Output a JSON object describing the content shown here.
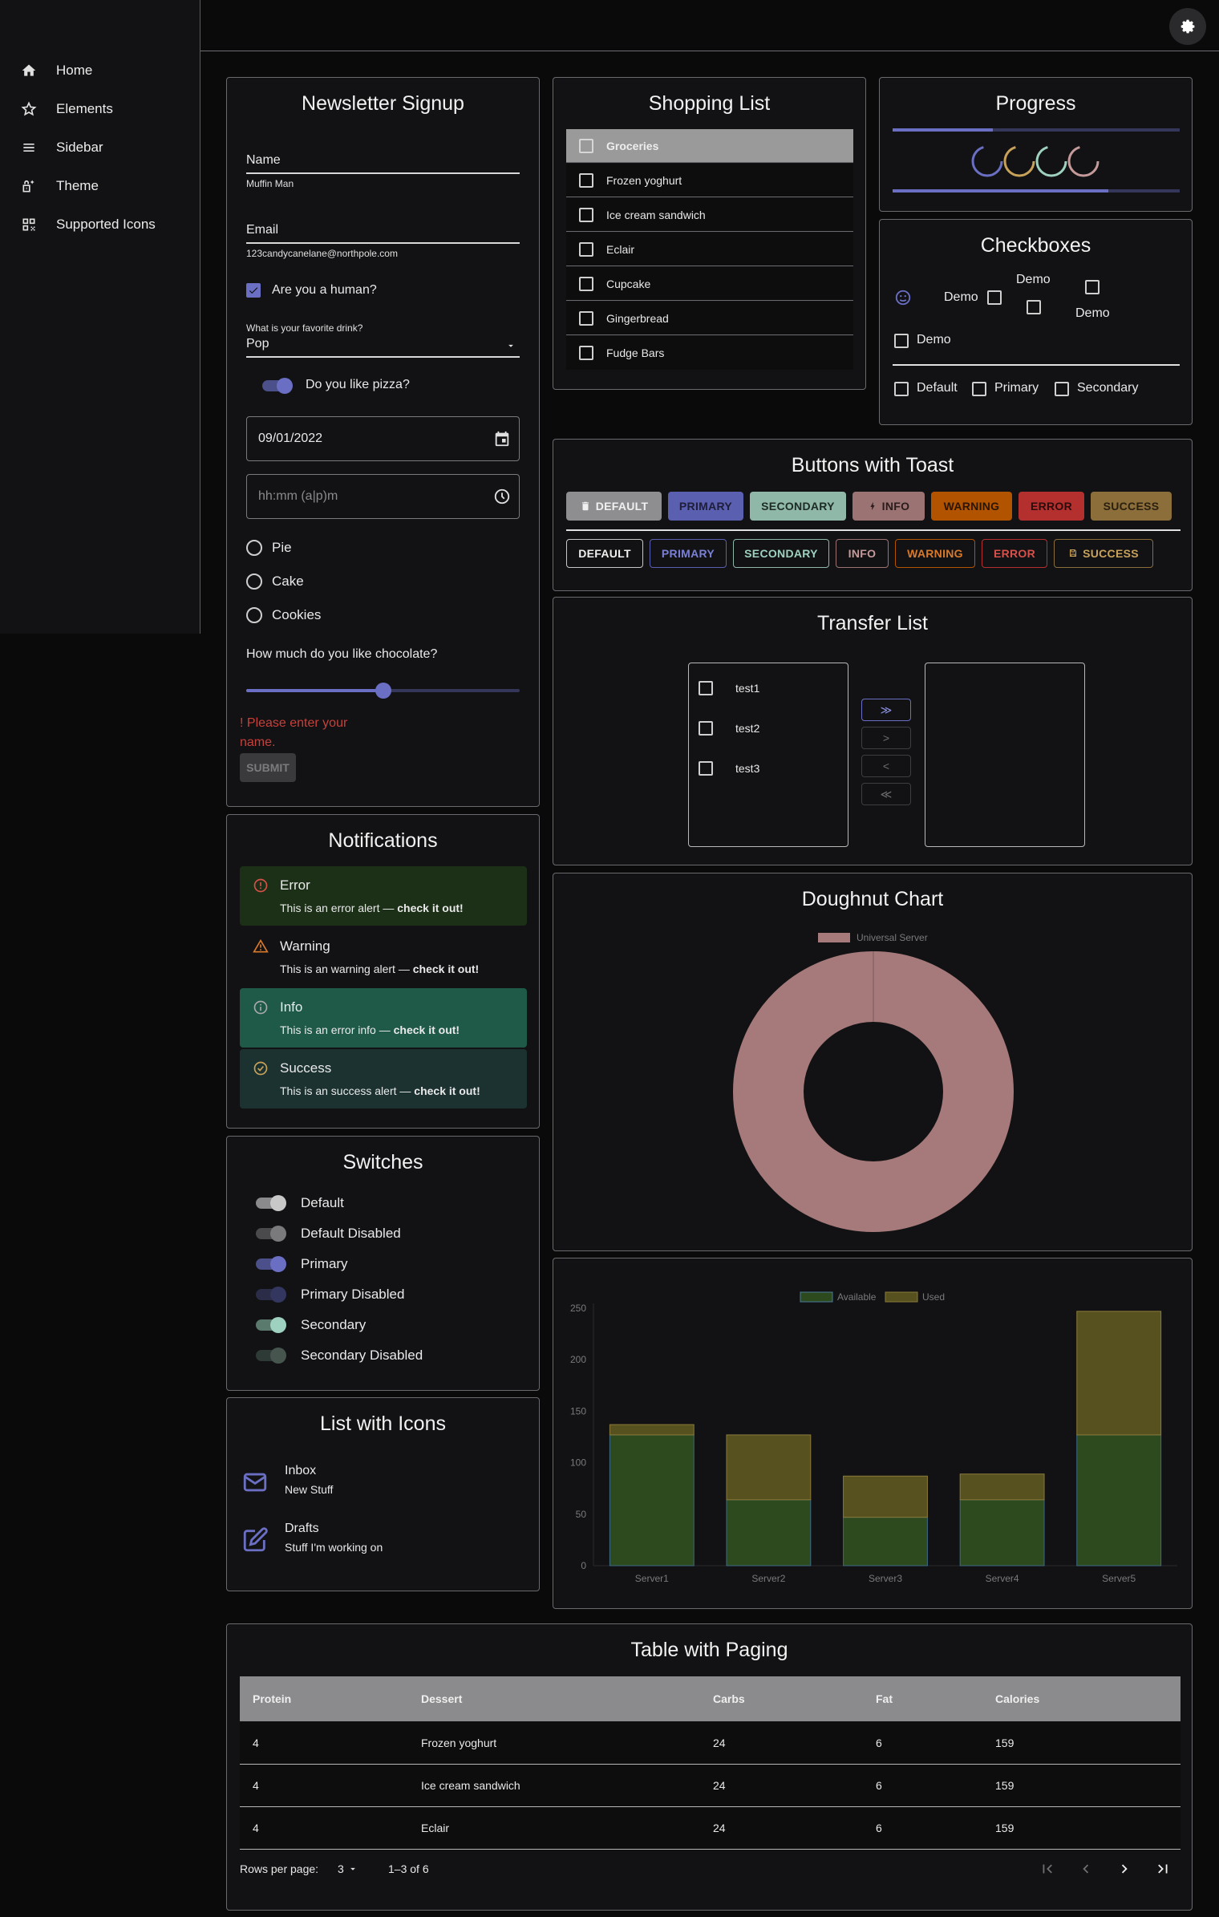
{
  "nav": {
    "items": [
      {
        "label": "Home",
        "icon": "home-icon"
      },
      {
        "label": "Elements",
        "icon": "star-icon"
      },
      {
        "label": "Sidebar",
        "icon": "menu-icon"
      },
      {
        "label": "Theme",
        "icon": "theme-lock-icon"
      },
      {
        "label": "Supported Icons",
        "icon": "icons-grid-icon"
      }
    ]
  },
  "newsletter": {
    "title": "Newsletter Signup",
    "name_label": "Name",
    "name_value": "Muffin Man",
    "email_label": "Email",
    "email_value": "123candycanelane@northpole.com",
    "human_label": "Are you a human?",
    "drink_label": "What is your favorite drink?",
    "drink_value": "Pop",
    "pizza_label": "Do you like pizza?",
    "date_value": "09/01/2022",
    "time_placeholder": "hh:mm (a|p)m",
    "radios": [
      "Pie",
      "Cake",
      "Cookies"
    ],
    "slider_label": "How much do you like chocolate?",
    "slider_value": 0.5,
    "error_line1": "! Please enter your",
    "error_line2": "name.",
    "submit_label": "SUBMIT"
  },
  "shopping": {
    "title": "Shopping List",
    "items": [
      "Groceries",
      "Frozen yoghurt",
      "Ice cream sandwich",
      "Eclair",
      "Cupcake",
      "Gingerbread",
      "Fudge Bars"
    ]
  },
  "progress": {
    "title": "Progress",
    "bar1": 0.35,
    "bar2": 0.75
  },
  "checkboxes": {
    "title": "Checkboxes",
    "demo": "Demo",
    "default": "Default",
    "primary": "Primary",
    "secondary": "Secondary"
  },
  "buttons": {
    "title": "Buttons with Toast",
    "contained": [
      "DEFAULT",
      "PRIMARY",
      "SECONDARY",
      "INFO",
      "WARNING",
      "ERROR",
      "SUCCESS"
    ],
    "outlined": [
      "DEFAULT",
      "PRIMARY",
      "SECONDARY",
      "INFO",
      "WARNING",
      "ERROR",
      "SUCCESS"
    ]
  },
  "transfer": {
    "title": "Transfer List",
    "left_items": [
      "test1",
      "test2",
      "test3"
    ],
    "btn_all_right": "≫",
    "btn_right": ">",
    "btn_left": "<",
    "btn_all_left": "≪"
  },
  "notifications": {
    "title": "Notifications",
    "alerts": [
      {
        "title": "Error",
        "text": "This is an error alert — ",
        "strong": "check it out!"
      },
      {
        "title": "Warning",
        "text": "This is an warning alert — ",
        "strong": "check it out!"
      },
      {
        "title": "Info",
        "text": "This is an error info — ",
        "strong": "check it out!"
      },
      {
        "title": "Success",
        "text": "This is an success alert — ",
        "strong": "check it out!"
      }
    ]
  },
  "switches": {
    "title": "Switches",
    "items": [
      "Default",
      "Default Disabled",
      "Primary",
      "Primary Disabled",
      "Secondary",
      "Secondary Disabled"
    ]
  },
  "list_icons": {
    "title": "List with Icons",
    "items": [
      {
        "primary": "Inbox",
        "secondary": "New Stuff"
      },
      {
        "primary": "Drafts",
        "secondary": "Stuff I'm working on"
      }
    ]
  },
  "table": {
    "title": "Table with Paging",
    "headers": [
      "Protein",
      "Dessert",
      "Carbs",
      "Fat",
      "Calories"
    ],
    "rows": [
      [
        "4",
        "Frozen yoghurt",
        "24",
        "6",
        "159"
      ],
      [
        "4",
        "Ice cream sandwich",
        "24",
        "6",
        "159"
      ],
      [
        "4",
        "Eclair",
        "24",
        "6",
        "159"
      ]
    ],
    "rows_per_page_label": "Rows per page:",
    "rows_per_page": "3",
    "range": "1–3 of 6"
  },
  "chart_data": [
    {
      "type": "pie",
      "title": "Doughnut Chart",
      "legend": [
        "Universal Server"
      ],
      "values": [
        100
      ],
      "colors": [
        "#a67a7a"
      ]
    },
    {
      "type": "bar",
      "stacked": true,
      "categories": [
        "Server1",
        "Server2",
        "Server3",
        "Server4",
        "Server5"
      ],
      "series": [
        {
          "name": "Available",
          "values": [
            127,
            64,
            47,
            64,
            127
          ],
          "color": "#2d4a1e"
        },
        {
          "name": "Used",
          "values": [
            10,
            63,
            40,
            25,
            120
          ],
          "color": "#57511f"
        }
      ],
      "yticks": [
        0,
        50,
        100,
        150,
        200,
        250
      ],
      "ylim": [
        0,
        250
      ]
    }
  ]
}
